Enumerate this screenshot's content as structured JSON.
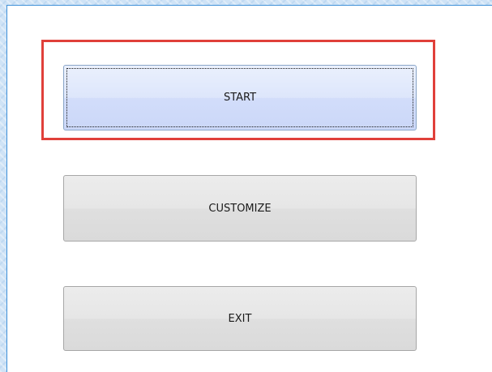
{
  "menu": {
    "buttons": [
      {
        "label": "START",
        "focused": true,
        "highlighted": true
      },
      {
        "label": "CUSTOMIZE",
        "focused": false,
        "highlighted": false
      },
      {
        "label": "EXIT",
        "focused": false,
        "highlighted": false
      }
    ]
  },
  "colors": {
    "highlight_border": "#e0403a",
    "panel_border": "#3d8fd8",
    "focused_button_bg": "#dde6fb"
  }
}
